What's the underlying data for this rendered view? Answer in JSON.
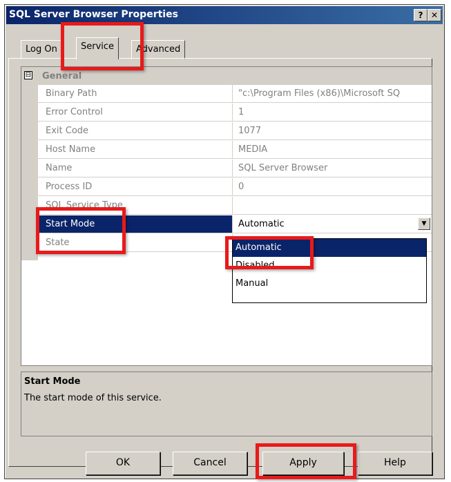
{
  "window": {
    "title": "SQL Server Browser Properties",
    "help_label": "?",
    "close_label": "✕"
  },
  "tabs": [
    {
      "label": "Log On"
    },
    {
      "label": "Service"
    },
    {
      "label": "Advanced"
    }
  ],
  "grid": {
    "category": {
      "expander": "⊟",
      "label": "General"
    },
    "rows": [
      {
        "name": "Binary Path",
        "value": "\"c:\\Program Files (x86)\\Microsoft SQ"
      },
      {
        "name": "Error Control",
        "value": "1"
      },
      {
        "name": "Exit Code",
        "value": "1077"
      },
      {
        "name": "Host Name",
        "value": "MEDIA"
      },
      {
        "name": "Name",
        "value": "SQL Server Browser"
      },
      {
        "name": "Process ID",
        "value": "0"
      },
      {
        "name": "SQL Service Type",
        "value": ""
      },
      {
        "name": "Start Mode",
        "value": "Automatic"
      },
      {
        "name": "State",
        "value": ""
      }
    ],
    "dropdown_options": [
      "Automatic",
      "Disabled",
      "Manual"
    ]
  },
  "description": {
    "title": "Start Mode",
    "text": "The start mode of this service."
  },
  "buttons": {
    "ok": "OK",
    "cancel": "Cancel",
    "apply": "Apply",
    "help": "Help"
  },
  "colors": {
    "title_bar": "#0a246a",
    "highlight": "#e81a1a",
    "selection": "#0a246a",
    "dialog_face": "#d4d0c8"
  }
}
